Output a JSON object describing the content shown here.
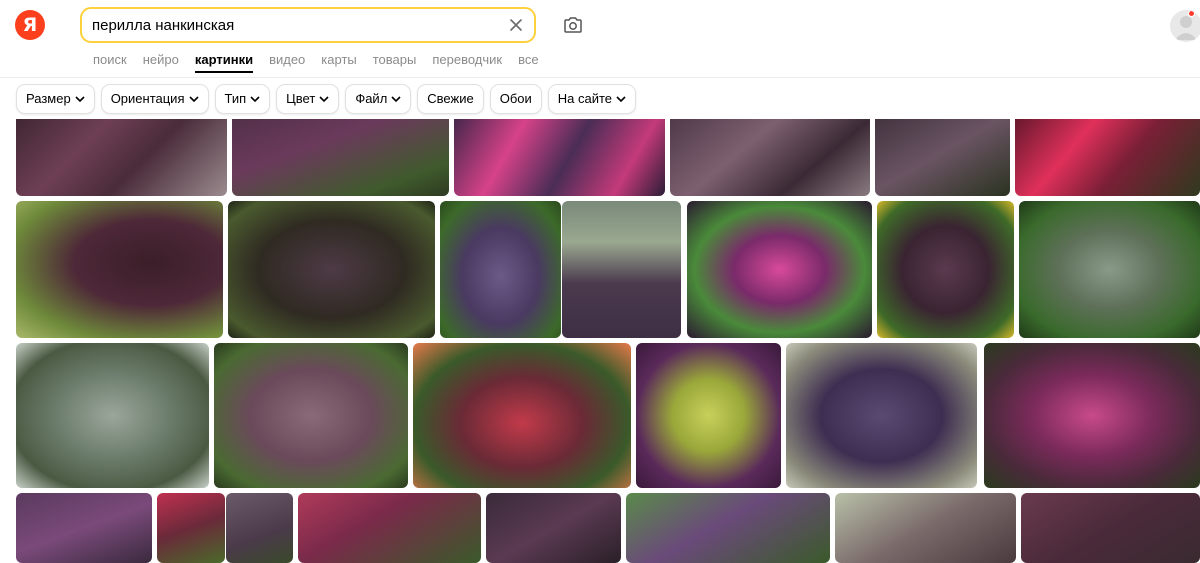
{
  "header": {
    "logo_letter": "Я",
    "search_value": "перилла нанкинская",
    "accent_color": "#fc3f1d",
    "search_border_color": "#fdd13c"
  },
  "tabs": [
    {
      "label": "поиск",
      "active": false
    },
    {
      "label": "нейро",
      "active": false
    },
    {
      "label": "картинки",
      "active": true
    },
    {
      "label": "видео",
      "active": false
    },
    {
      "label": "карты",
      "active": false
    },
    {
      "label": "товары",
      "active": false
    },
    {
      "label": "переводчик",
      "active": false
    },
    {
      "label": "все",
      "active": false
    }
  ],
  "filters": [
    {
      "label": "Размер",
      "dropdown": true
    },
    {
      "label": "Ориентация",
      "dropdown": true
    },
    {
      "label": "Тип",
      "dropdown": true
    },
    {
      "label": "Цвет",
      "dropdown": true
    },
    {
      "label": "Файл",
      "dropdown": true
    },
    {
      "label": "Свежие",
      "dropdown": false
    },
    {
      "label": "Обои",
      "dropdown": false
    },
    {
      "label": "На сайте",
      "dropdown": true
    }
  ],
  "icons": {
    "clear": "close-icon",
    "camera": "camera-search-icon",
    "chevron": "chevron-down-icon"
  }
}
